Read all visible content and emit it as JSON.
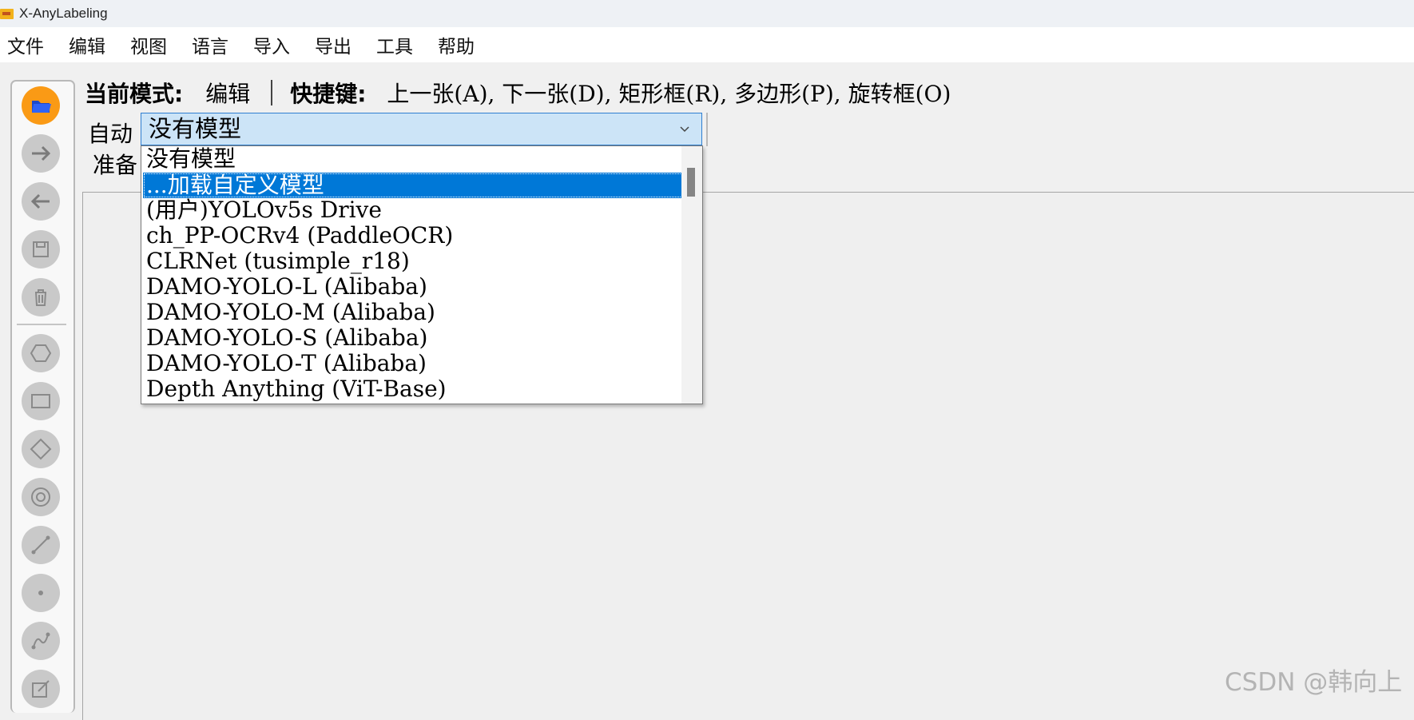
{
  "window": {
    "title": "X-AnyLabeling",
    "icon": "app-logo-icon"
  },
  "menu": [
    "文件",
    "编辑",
    "视图",
    "语言",
    "导入",
    "导出",
    "工具",
    "帮助"
  ],
  "status": {
    "mode_label": "当前模式:",
    "mode_value": "编辑",
    "shortcut_label": "快捷键:",
    "shortcuts": "上一张(A), 下一张(D), 矩形框(R), 多边形(P), 旋转框(O)"
  },
  "auto": {
    "label": "自动",
    "ready_label": "准备",
    "selected_value": "没有模型"
  },
  "dropdown": {
    "items": [
      "没有模型",
      "...加载自定义模型",
      "(用户)YOLOv5s Drive",
      "ch_PP-OCRv4 (PaddleOCR)",
      "CLRNet (tusimple_r18)",
      "DAMO-YOLO-L (Alibaba)",
      "DAMO-YOLO-M (Alibaba)",
      "DAMO-YOLO-S (Alibaba)",
      "DAMO-YOLO-T (Alibaba)",
      "Depth Anything (ViT-Base)"
    ],
    "highlighted_index": 1
  },
  "toolbar": {
    "icons": [
      "open-folder-icon",
      "next-image-icon",
      "prev-image-icon",
      "save-icon",
      "delete-icon",
      "polygon-icon",
      "rectangle-icon",
      "rotation-icon",
      "circle-icon",
      "line-icon",
      "point-icon",
      "linestrip-icon",
      "edit-icon"
    ]
  },
  "colors": {
    "accent": "#0078d7",
    "active_tool": "#fa9a15",
    "combo_bg": "#cce4f7"
  },
  "watermark": "CSDN @韩向上"
}
